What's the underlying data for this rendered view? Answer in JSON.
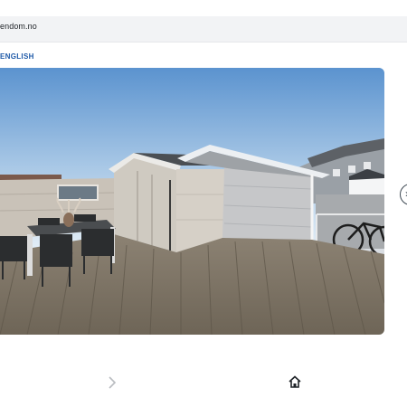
{
  "browser": {
    "url_text": "endom.no"
  },
  "page": {
    "language_link": "ENGLISH"
  },
  "gallery": {
    "image_alt": ""
  },
  "icons": {
    "forward": "chevron-right-icon",
    "home": "home-icon",
    "next_image": "chevron-right-icon"
  },
  "colors": {
    "link": "#1f5aa8",
    "url_bar_bg": "#f2f3f5"
  }
}
